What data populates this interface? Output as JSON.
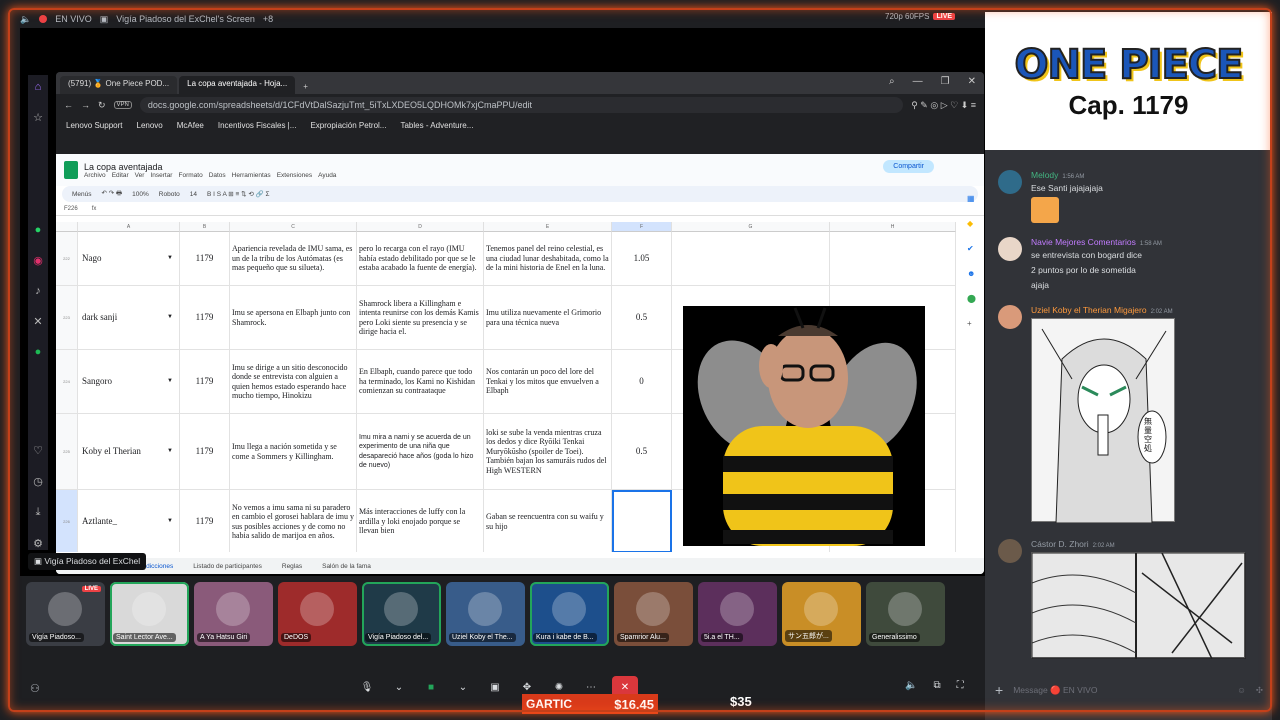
{
  "stream_header": {
    "live_label": "EN VIVO",
    "screen_title": "Vigía Piadoso del ExChel's Screen",
    "extra_count": "+8",
    "quality": "720p 60FPS",
    "live_badge": "LIVE"
  },
  "browser": {
    "tabs": [
      {
        "label": "(5791) 🏅 One Piece POD..."
      },
      {
        "label": "La copa aventajada - Hoja..."
      }
    ],
    "vpn_label": "VPN",
    "url": "docs.google.com/spreadsheets/d/1CFdVtDalSazjuTmt_5iTxLXDEO5LQDHOMk7xjCmaPPU/edit",
    "bookmarks": [
      "Lenovo Support",
      "Lenovo",
      "McAfee",
      "Incentivos Fiscales |...",
      "Expropiación Petrol...",
      "Tables - Adventure..."
    ]
  },
  "sheet": {
    "title": "La copa aventajada",
    "menu": [
      "Archivo",
      "Editar",
      "Ver",
      "Insertar",
      "Formato",
      "Datos",
      "Herramientas",
      "Extensiones",
      "Ayuda"
    ],
    "share_label": "Compartir",
    "toolbar": {
      "menus": "Menús",
      "zoom": "100%",
      "font": "Roboto",
      "size": "14"
    },
    "cell_ref": "F226",
    "columns": [
      "A",
      "B",
      "C",
      "D",
      "E",
      "F",
      "G",
      "H"
    ],
    "rows": [
      {
        "num": "222",
        "name": "Nago",
        "cap": "1179",
        "c": "Apariencia revelada de IMU sama, es un de la tribu de los Autómatas (es mas pequeño que su silueta).",
        "d": "pero lo recarga con el rayo (IMU había estado debilitado por que se le estaba acabado la fuente de energía).",
        "e": "Tenemos panel del reino celestial, es una ciudad lunar deshabitada, como la de la mini historia de Enel en la luna.",
        "f": "1.05"
      },
      {
        "num": "223",
        "name": "dark sanji",
        "cap": "1179",
        "c": "Imu se apersona en Elbaph junto con Shamrock.",
        "d": "Shamrock libera a Killingham e intenta reunirse con los demás Kamis pero Loki siente su presencia y se dirige hacia el.",
        "e": "Imu utiliza nuevamente el Grimorio para una técnica nueva",
        "f": "0.5"
      },
      {
        "num": "224",
        "name": "Sangoro",
        "cap": "1179",
        "c": "Imu se dirige a un sitio desconocido donde se entrevista con alguien a quien hemos estado esperando hace mucho tiempo, Hinokizu",
        "d": "En Elbaph, cuando parece que todo ha terminado, los Kami no Kishidan comienzan su contraataque",
        "e": "Nos contarán un poco del lore del Tenkai y los mitos que envuelven a Elbaph",
        "f": "0"
      },
      {
        "num": "225",
        "name": "Koby el Therian",
        "cap": "1179",
        "c": "Imu llega a nación sometida y se come a Sommers y Killingham.",
        "d": "Imu mira a nami y se acuerda de un experimento de una niña que desapareció hace años (goda lo hizo de nuevo)",
        "e": "loki se sube la venda mientras cruza los dedos y dice Ryōiki Tenkai Muryōkūsho (spoiler de Toei). También bajan los samuráis rudos del High WESTERN",
        "f": "0.5"
      },
      {
        "num": "226",
        "name": "Aztlante_",
        "cap": "1179",
        "c": "No vemos a imu sama ni su paradero en cambio el gorosei hablara de imu y sus posibles acciones y de como no habia salido de marijoa en años.",
        "d": "Más interacciones de luffy con la ardilla y loki enojado porque se llevan bien",
        "e": "Gaban se reencuentra con su waifu y su hijo",
        "f": ""
      }
    ],
    "sheet_tabs": [
      "Predicciones",
      "Listado de participantes",
      "Reglas",
      "Salón de la fama"
    ]
  },
  "share_tooltip": "Vigía Piadoso del ExChel",
  "participants": [
    {
      "name": "Vigía Piadoso...",
      "live": "LIVE",
      "bg": "#3a3d44"
    },
    {
      "name": "Saint Lector Ave...",
      "bg": "#d9d9d9"
    },
    {
      "name": "A Ya Hatsu Giri",
      "bg": "#8a5a7a"
    },
    {
      "name": "DeDOS",
      "bg": "#9e2b2b"
    },
    {
      "name": "Vigía Piadoso del...",
      "bg": "#1f3a48"
    },
    {
      "name": "Uziel Koby el The...",
      "bg": "#385c8a"
    },
    {
      "name": "Kura i kabe de B...",
      "bg": "#1d4f8c"
    },
    {
      "name": "Spamrior Alu...",
      "bg": "#7a4e3a"
    },
    {
      "name": "5i.a el TH...",
      "bg": "#5c2f5c"
    },
    {
      "name": "サン五郎が...",
      "bg": "#c98e26"
    },
    {
      "name": "Generalissimo",
      "bg": "#3f4a3c"
    }
  ],
  "overlay": {
    "game": "GARTIC",
    "amount1": "$16.45",
    "amount2": "$35"
  },
  "brand": {
    "logo": "ONE PIECE",
    "chapter": "Cap. 1179"
  },
  "chat": {
    "messages": [
      {
        "author": "Melody",
        "time": "1:56 AM",
        "color": "#43b581",
        "lines": [
          "Ese Santi jajajajaja"
        ]
      },
      {
        "author": "Navie Mejores Comentarios",
        "time": "1:58 AM",
        "color": "#c27cff",
        "lines": [
          "se entrevista con bogard dice",
          "2 puntos por lo de sometida",
          "ajaja"
        ]
      },
      {
        "author": "Uziel Koby el Therian Migajero",
        "time": "2:02 AM",
        "color": "#ff9a3c",
        "lines": []
      },
      {
        "author": "Cástor D. Zhori",
        "time": "2:02 AM",
        "color": "#949ba4",
        "lines": []
      }
    ],
    "manga_text": "無量空処",
    "input_placeholder": "Message 🔴 EN VIVO"
  },
  "colors": {
    "accent_border": "#c3401a",
    "discord_bg": "#313338",
    "sheets_green": "#0f9d58"
  }
}
